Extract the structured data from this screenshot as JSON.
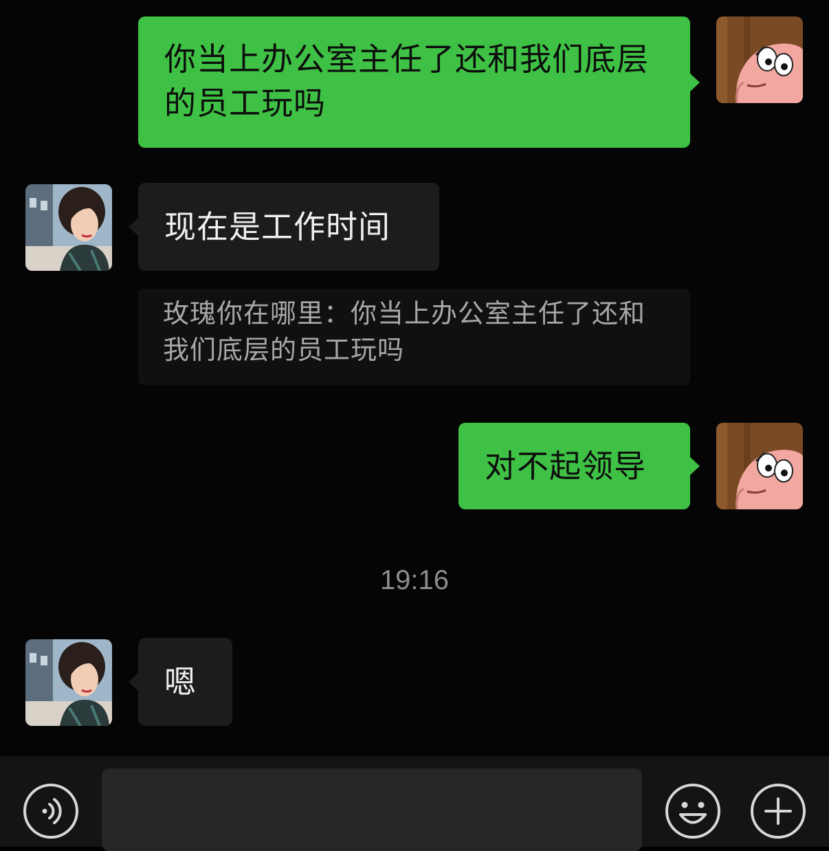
{
  "conversation": {
    "messages": [
      {
        "id": "m1",
        "direction": "out",
        "text": "你当上办公室主任了还和我们底层的员工玩吗"
      },
      {
        "id": "m2",
        "direction": "in",
        "text": "现在是工作时间",
        "quote": "玫瑰你在哪里：你当上办公室主任了还和我们底层的员工玩吗"
      },
      {
        "id": "m3",
        "direction": "out",
        "text": "对不起领导"
      },
      {
        "id": "m4",
        "direction": "in",
        "text": "嗯"
      }
    ],
    "timestamp": "19:16"
  },
  "input_bar": {
    "voice_icon": "voice-input-icon",
    "emoji_icon": "emoji-icon",
    "more_icon": "plus-icon",
    "input_value": ""
  },
  "colors": {
    "background": "#050505",
    "outgoing_bubble": "#3ec144",
    "incoming_bubble": "#1c1c1c",
    "quote_text": "#a8a8a8",
    "timestamp_text": "#8d8d8d"
  }
}
